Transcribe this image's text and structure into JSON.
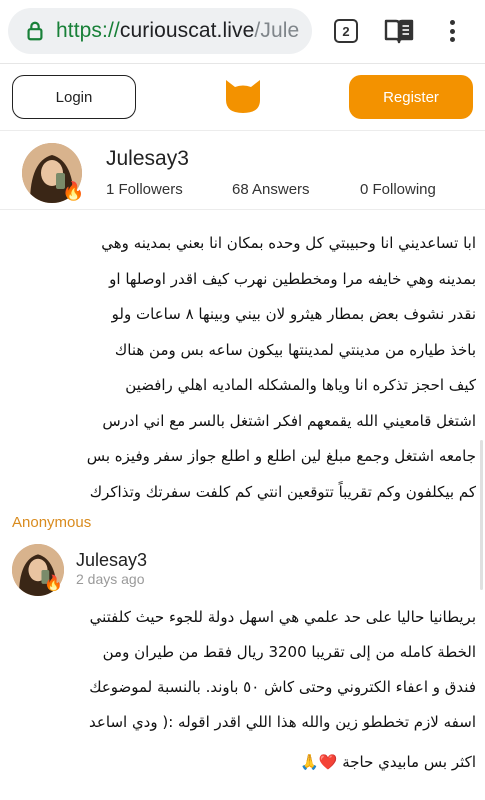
{
  "browser": {
    "url_scheme": "https://",
    "url_host": "curiouscat.live",
    "url_path": "/Jule",
    "tab_count": "2",
    "icons": [
      "lock-icon",
      "tab-switcher-icon",
      "reader-mode-icon",
      "overflow-menu-icon"
    ]
  },
  "header": {
    "login_label": "Login",
    "register_label": "Register",
    "logo_icon": "cat-head-icon",
    "accent_color": "#f39200"
  },
  "profile": {
    "username": "Julesay3",
    "followers": "1 Followers",
    "answers": "68 Answers",
    "following": "0 Following",
    "badge_icon": "fire-icon"
  },
  "question": {
    "lines": [
      "ابا تساعديني انا وحبيبتي كل وحده بمكان انا بعني بمدينه وهي",
      "بمدينه وهي خايفه مرا ومخططين نهرب كيف اقدر اوصلها او",
      "نقدر نشوف بعض بمطار هيثرو لان بيني وبينها ٨ ساعات  ولو",
      "باخذ طياره من مدينتي لمدينتها بيكون  ساعه بس ومن هناك",
      "كيف احجز تذكره انا وياها والمشكله الماديه اهلي رافضين",
      "اشتغل قامعيني الله يقمعهم  افكر اشتغل بالسر مع اني ادرس",
      "جامعه اشتغل وجمع مبلغ لين اطلع و اطلع جواز سفر وفيزه بس",
      "كم بيكلفون وكم تقريباً تتوقعين  انتي كم كلفت سفرتك وتذاكرك"
    ],
    "author": "Anonymous"
  },
  "answer": {
    "author": "Julesay3",
    "time": "2 days ago",
    "lines": [
      "بريطانيا حاليا على حد علمي هي اسهل دولة للجوء حيث كلفتني",
      "الخطة كامله من إلى تقريبا 3200 ريال فقط من طيران ومن",
      "فندق و اعفاء الكتروني وحتى كاش ٥٠ باوند. بالنسبة لموضوعك",
      "اسفه لازم تخططو زين والله هذا اللي اقدر اقوله :( ودي اساعد"
    ],
    "last_line": "اكثر بس مابيدي حاجة ❤️🙏"
  }
}
